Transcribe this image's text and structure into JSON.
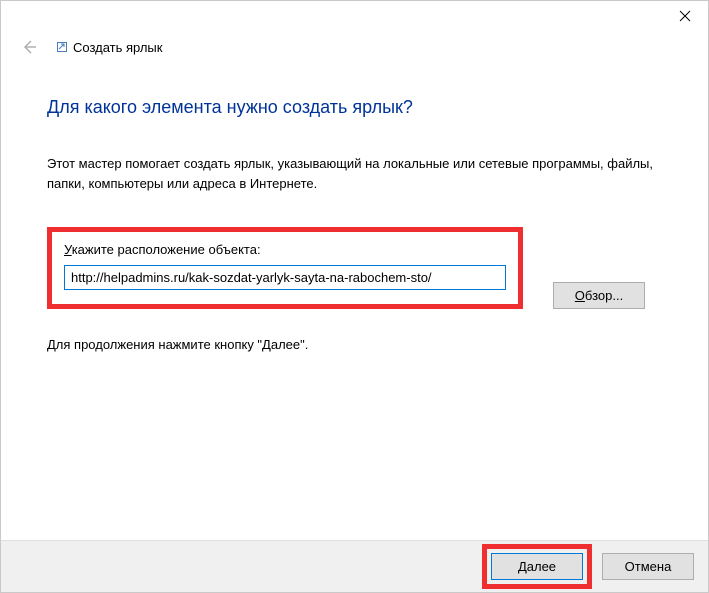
{
  "window": {
    "title": "Создать ярлык"
  },
  "wizard": {
    "heading": "Для какого элемента нужно создать ярлык?",
    "description": "Этот мастер помогает создать ярлык, указывающий на локальные или сетевые программы, файлы, папки, компьютеры или адреса в Интернете.",
    "location_label": "Укажите расположение объекта:",
    "location_value": "http://helpadmins.ru/kak-sozdat-yarlyk-sayta-na-rabochem-sto/",
    "browse_label": "Обзор...",
    "continue_hint": "Для продолжения нажмите кнопку \"Далее\"."
  },
  "buttons": {
    "next": "Далее",
    "cancel": "Отмена"
  },
  "highlights": {
    "color": "#ef2f2f"
  }
}
